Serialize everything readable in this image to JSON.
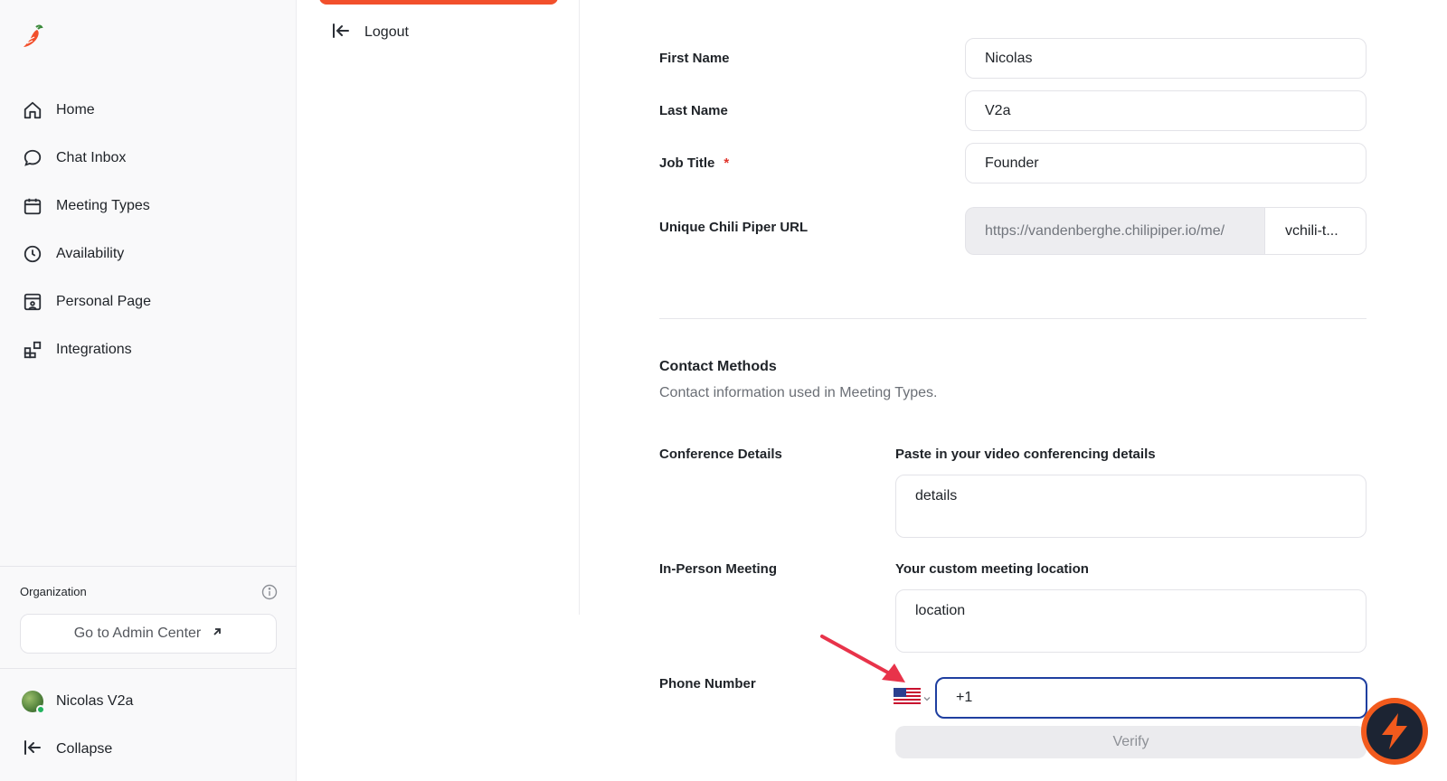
{
  "sidebar": {
    "items": [
      {
        "label": "Home",
        "icon": "home-icon"
      },
      {
        "label": "Chat Inbox",
        "icon": "chat-bubble-icon"
      },
      {
        "label": "Meeting Types",
        "icon": "calendar-icon"
      },
      {
        "label": "Availability",
        "icon": "clock-icon"
      },
      {
        "label": "Personal Page",
        "icon": "personal-page-icon"
      },
      {
        "label": "Integrations",
        "icon": "integrations-icon"
      }
    ],
    "organization": {
      "title": "Organization",
      "admin_button": "Go to Admin Center"
    },
    "user_name": "Nicolas V2a",
    "collapse_label": "Collapse"
  },
  "mid": {
    "logout_label": "Logout"
  },
  "form": {
    "first_name": {
      "label": "First Name",
      "value": "Nicolas"
    },
    "last_name": {
      "label": "Last Name",
      "value": "V2a"
    },
    "job_title": {
      "label": "Job Title",
      "required": "*",
      "value": "Founder"
    },
    "url": {
      "label": "Unique Chili Piper URL",
      "prefix": "https://vandenberghe.chilipiper.io/me/",
      "suffix": "vchili-t..."
    }
  },
  "contact": {
    "title": "Contact Methods",
    "subtitle": "Contact information used in Meeting Types.",
    "conference": {
      "label": "Conference Details",
      "sublabel": "Paste in your video conferencing details",
      "value": "details"
    },
    "in_person": {
      "label": "In-Person Meeting",
      "sublabel": "Your custom meeting location",
      "value": "location"
    },
    "phone": {
      "label": "Phone Number",
      "value": "+1",
      "verify_label": "Verify"
    }
  },
  "colors": {
    "accent": "#f2502c",
    "focus_border": "#1f3fa0",
    "annotation_arrow": "#e8334a"
  }
}
